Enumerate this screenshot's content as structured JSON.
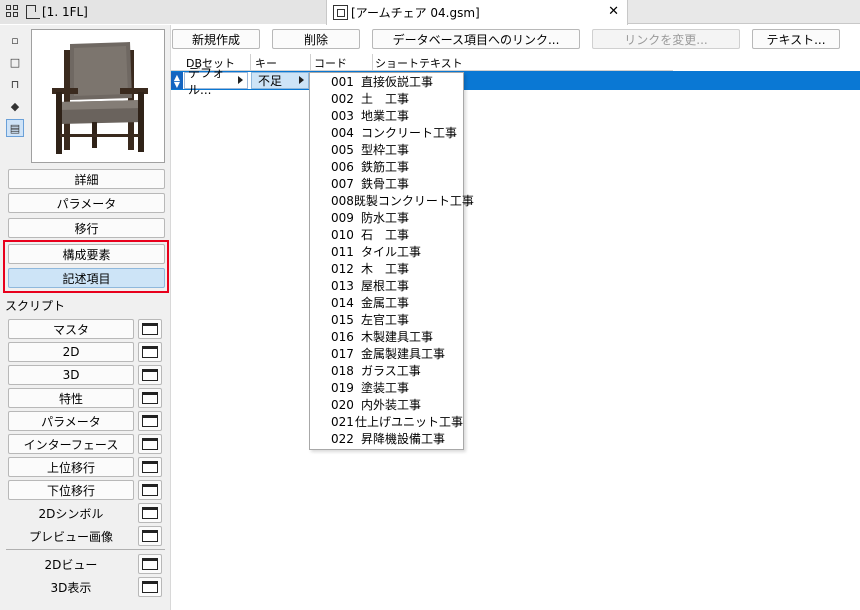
{
  "tabs": {
    "floor": "[1. 1FL]",
    "object": "[アームチェア 04.gsm]",
    "close": "✕"
  },
  "side": {
    "buttons": {
      "detail": "詳細",
      "parameter": "パラメータ",
      "migration": "移行",
      "component": "構成要素",
      "description": "記述項目"
    },
    "scripts_label": "スクリプト",
    "scripts": [
      "マスタ",
      "2D",
      "3D",
      "特性",
      "パラメータ",
      "インターフェース",
      "上位移行",
      "下位移行"
    ],
    "extra_buttons": [
      "2Dシンボル",
      "プレビュー画像"
    ],
    "views": [
      "2Dビュー",
      "3D表示"
    ]
  },
  "toolbar": {
    "new": "新規作成",
    "delete": "削除",
    "db_link": "データベース項目へのリンク...",
    "change_link": "リンクを変更...",
    "text": "テキスト..."
  },
  "table": {
    "headers": [
      "DBセット",
      "キー",
      "コード",
      "ショートテキスト"
    ],
    "row": {
      "dbset": "デフォル...",
      "key": "不足"
    }
  },
  "menu": {
    "items": [
      {
        "code": "001",
        "name": "直接仮説工事"
      },
      {
        "code": "002",
        "name": "土　工事"
      },
      {
        "code": "003",
        "name": "地業工事"
      },
      {
        "code": "004",
        "name": "コンクリート工事"
      },
      {
        "code": "005",
        "name": "型枠工事"
      },
      {
        "code": "006",
        "name": "鉄筋工事"
      },
      {
        "code": "007",
        "name": "鉄骨工事"
      },
      {
        "code": "008",
        "name": "既製コンクリート工事"
      },
      {
        "code": "009",
        "name": "防水工事"
      },
      {
        "code": "010",
        "name": "石　工事"
      },
      {
        "code": "011",
        "name": "タイル工事"
      },
      {
        "code": "012",
        "name": "木　工事"
      },
      {
        "code": "013",
        "name": "屋根工事"
      },
      {
        "code": "014",
        "name": "金属工事"
      },
      {
        "code": "015",
        "name": "左官工事"
      },
      {
        "code": "016",
        "name": "木製建具工事"
      },
      {
        "code": "017",
        "name": "金属製建具工事"
      },
      {
        "code": "018",
        "name": "ガラス工事"
      },
      {
        "code": "019",
        "name": "塗装工事"
      },
      {
        "code": "020",
        "name": "内外装工事"
      },
      {
        "code": "021",
        "name": "仕上げユニット工事"
      },
      {
        "code": "022",
        "name": "昇降機設備工事"
      }
    ]
  }
}
